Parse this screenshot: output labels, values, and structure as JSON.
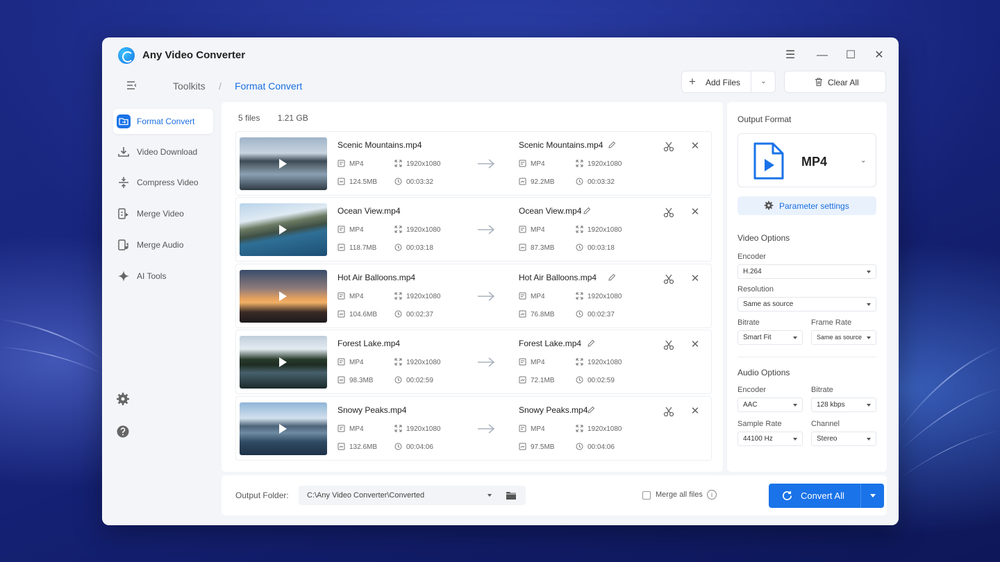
{
  "app": {
    "title": "Any Video Converter"
  },
  "window_controls": {
    "menu": "☰",
    "minimize": "—",
    "maximize": "☐",
    "close": "✕"
  },
  "breadcrumb": {
    "parent": "Toolkits",
    "separator": "/",
    "current": "Format Convert"
  },
  "toolbar": {
    "add_files_label": "Add Files",
    "clear_all_label": "Clear All"
  },
  "sidebar": {
    "items": [
      {
        "label": "Format Convert",
        "icon": "folder-convert-icon",
        "active": true
      },
      {
        "label": "Video Download",
        "icon": "download-icon"
      },
      {
        "label": "Compress Video",
        "icon": "compress-icon"
      },
      {
        "label": "Merge Video",
        "icon": "merge-video-icon"
      },
      {
        "label": "Merge Audio",
        "icon": "merge-audio-icon"
      },
      {
        "label": "AI Tools",
        "icon": "sparkle-icon"
      }
    ]
  },
  "files_summary": {
    "count": "5 files",
    "size": "1.21 GB"
  },
  "files": [
    {
      "name": "Scenic Mountains.mp4",
      "format": "MP4",
      "resolution": "1920x1080",
      "size": "124.5MB",
      "duration": "00:03:32",
      "out_name": "Scenic Mountains.mp4",
      "out_format": "MP4",
      "out_resolution": "1920x1080",
      "out_size": "92.2MB",
      "out_duration": "00:03:32"
    },
    {
      "name": "Ocean View.mp4",
      "format": "MP4",
      "resolution": "1920x1080",
      "size": "118.7MB",
      "duration": "00:03:18",
      "out_name": "Ocean View.mp4",
      "out_format": "MP4",
      "out_resolution": "1920x1080",
      "out_size": "87.3MB",
      "out_duration": "00:03:18"
    },
    {
      "name": "Hot Air Balloons.mp4",
      "format": "MP4",
      "resolution": "1920x1080",
      "size": "104.6MB",
      "duration": "00:02:37",
      "out_name": "Hot Air Balloons.mp4",
      "out_format": "MP4",
      "out_resolution": "1920x1080",
      "out_size": "76.8MB",
      "out_duration": "00:02:37"
    },
    {
      "name": "Forest Lake.mp4",
      "format": "MP4",
      "resolution": "1920x1080",
      "size": "98.3MB",
      "duration": "00:02:59",
      "out_name": "Forest Lake.mp4",
      "out_format": "MP4",
      "out_resolution": "1920x1080",
      "out_size": "72.1MB",
      "out_duration": "00:02:59"
    },
    {
      "name": "Snowy Peaks.mp4",
      "format": "MP4",
      "resolution": "1920x1080",
      "size": "132.6MB",
      "duration": "00:04:06",
      "out_name": "Snowy Peaks.mp4",
      "out_format": "MP4",
      "out_resolution": "1920x1080",
      "out_size": "97.5MB",
      "out_duration": "00:04:06"
    }
  ],
  "output_format": {
    "title": "Output Format",
    "format": "MP4",
    "parameter_settings": "Parameter settings",
    "video_options_title": "Video Options",
    "video": {
      "encoder_label": "Encoder",
      "encoder": "H.264",
      "resolution_label": "Resolution",
      "resolution": "Same as source",
      "bitrate_label": "Bitrate",
      "bitrate": "Smart Fit",
      "frame_rate_label": "Frame Rate",
      "frame_rate": "Same as source"
    },
    "audio_options_title": "Audio Options",
    "audio": {
      "encoder_label": "Encoder",
      "encoder": "AAC",
      "bitrate_label": "Bitrate",
      "bitrate": "128 kbps",
      "sample_rate_label": "Sample Rate",
      "sample_rate": "44100 Hz",
      "channel_label": "Channel",
      "channel": "Stereo"
    }
  },
  "bottom": {
    "output_folder_label": "Output Folder:",
    "output_folder": "C:\\Any Video Converter\\Converted",
    "merge_label": "Merge all files",
    "info": "i",
    "convert_label": "Convert All"
  },
  "colors": {
    "accent": "#1a73e8",
    "window_bg": "#f3f5f9",
    "desktop_bg": "#16237a"
  }
}
